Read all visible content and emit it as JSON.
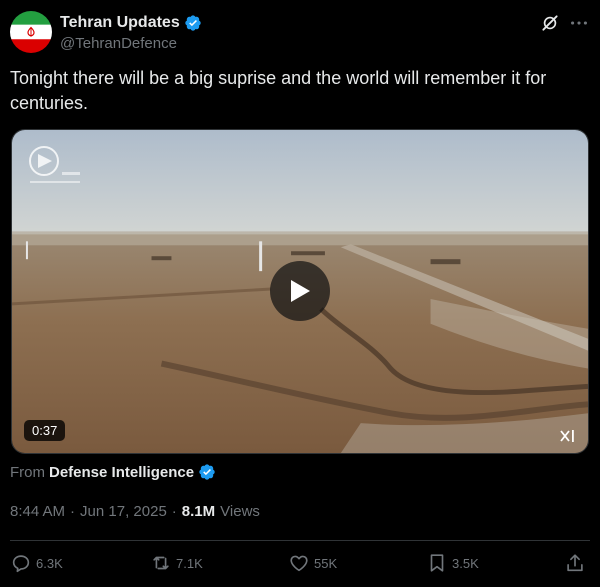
{
  "author": {
    "display_name": "Tehran Updates",
    "handle": "@TehranDefence"
  },
  "tweet": {
    "text": "Tonight there will be a big suprise and the world will remember it for centuries."
  },
  "media": {
    "duration": "0:37"
  },
  "source": {
    "from_label": "From",
    "name": "Defense Intelligence"
  },
  "meta": {
    "time": "8:44 AM",
    "date": "Jun 17, 2025",
    "views_count": "8.1M",
    "views_label": "Views"
  },
  "actions": {
    "replies": "6.3K",
    "reposts": "7.1K",
    "likes": "55K",
    "bookmarks": "3.5K"
  },
  "colors": {
    "verified": "#1d9bf0",
    "muted_text": "#71767b",
    "primary_text": "#e7e9ea"
  }
}
